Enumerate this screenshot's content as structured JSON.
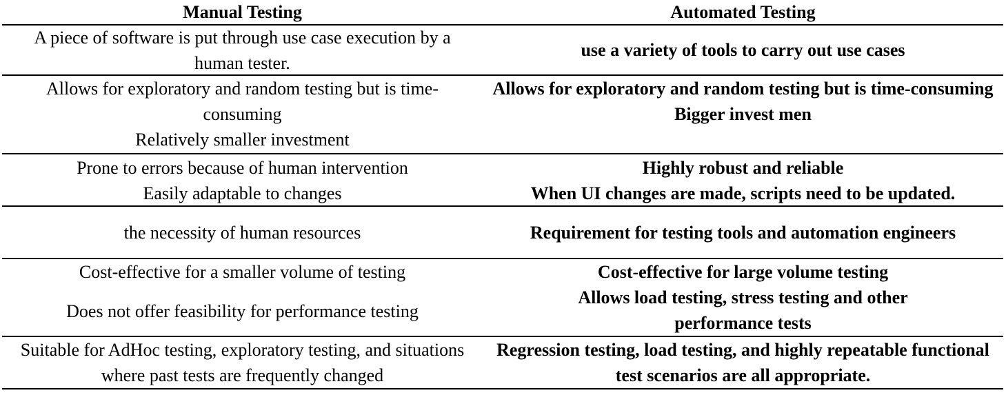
{
  "table": {
    "headers": {
      "manual": "Manual Testing",
      "automated": "Automated Testing"
    },
    "rows": [
      {
        "manual": [
          "A piece of software is put through use case execution by a human tester."
        ],
        "automated": [
          "use a variety of tools to carry out use cases"
        ]
      },
      {
        "manual": [
          "Allows for exploratory and random testing but is time-consuming"
        ],
        "automated": [
          "Allows for exploratory and random testing but is time-consuming"
        ]
      },
      {
        "manual": [
          "Relatively smaller investment"
        ],
        "automated": [
          "Bigger invest men"
        ]
      },
      {
        "manual": [
          "Prone to errors because of human intervention",
          "Easily adaptable to changes"
        ],
        "automated": [
          "Highly robust and reliable",
          "When UI changes are made, scripts need to be updated."
        ]
      },
      {
        "manual": [
          "the necessity of human resources"
        ],
        "automated": [
          "Requirement for testing tools and automation engineers"
        ]
      },
      {
        "manual": [
          "Cost-effective for a smaller volume of testing",
          "Does not offer feasibility for performance testing"
        ],
        "automated": [
          "Cost-effective for large volume testing",
          "Allows load testing, stress testing and other performance tests"
        ]
      },
      {
        "manual": [
          "Suitable for AdHoc testing, exploratory testing, and situations where past tests are frequently changed"
        ],
        "automated": [
          "Regression testing, load testing, and highly repeatable functional test scenarios are all appropriate."
        ]
      }
    ]
  }
}
